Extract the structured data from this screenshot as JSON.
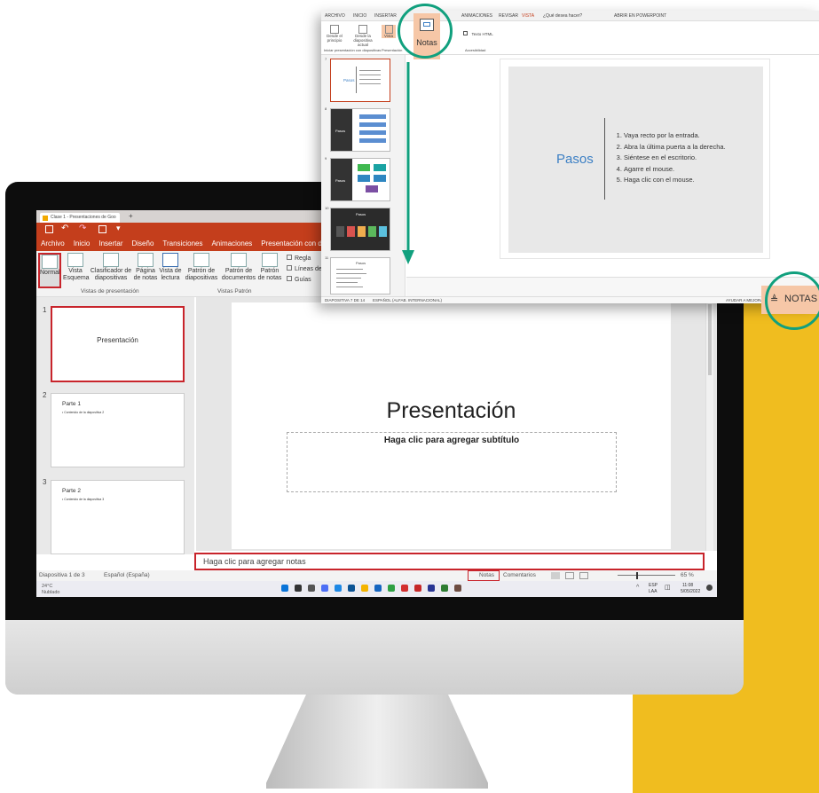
{
  "screen": {
    "window_title": "Clase 1 - Presentaciones de Goo",
    "tabs": [
      "Archivo",
      "Inicio",
      "Insertar",
      "Diseño",
      "Transiciones",
      "Animaciones",
      "Presentación con diapositivas"
    ],
    "ribbon_buttons": [
      {
        "id": "normal",
        "label": "Normal"
      },
      {
        "id": "esquema",
        "label": "Vista Esquema"
      },
      {
        "id": "clasificador",
        "label": "Clasificador de diapositivas"
      },
      {
        "id": "pagina-notas",
        "label": "Página de notas"
      },
      {
        "id": "lectura",
        "label": "Vista de lectura"
      },
      {
        "id": "patron-diap",
        "label": "Patrón de diapositivas"
      },
      {
        "id": "patron-docs",
        "label": "Patrón de documentos"
      },
      {
        "id": "patron-notas",
        "label": "Patrón de notas"
      }
    ],
    "checkboxes": [
      "Regla",
      "Líneas de",
      "Guías"
    ],
    "groups": [
      "Vistas de presentación",
      "Vistas Patrón"
    ],
    "thumbnails": [
      {
        "num": "1",
        "title": "Presentación",
        "bullet": ""
      },
      {
        "num": "2",
        "title": "Parte 1",
        "bullet": "• Contenido de la diapositiva 2"
      },
      {
        "num": "3",
        "title": "Parte 2",
        "bullet": "• Contenido de la diapositiva 3"
      }
    ],
    "slide_title": "Presentación",
    "slide_subtitle": "Haga clic para agregar subtítulo",
    "notes_placeholder": "Haga clic para agregar notas",
    "status_left": "Diapositiva 1 de 3",
    "status_lang": "Español (España)",
    "status_notes": "Notas",
    "status_comments": "Comentarios",
    "zoom": "65 %",
    "weather_temp": "24°C",
    "weather_desc": "Nublado",
    "tray_lang": "ESP",
    "tray_region": "LAA",
    "clock_time": "11:08",
    "clock_date": "5/05/2022"
  },
  "overlay": {
    "tabs": [
      "ARCHIVO",
      "INICIO",
      "INSERTAR",
      "ANIMACIONES",
      "REVISAR",
      "VISTA",
      "¿Qué desea hacer?",
      "ABRIR EN POWERPOINT"
    ],
    "ribbon": {
      "desde_principio": "Desde el principio",
      "desde_actual": "Desde la diapositiva actual",
      "vista": "Vista",
      "notas": "Notas",
      "texto_html": "Texto HTML",
      "grupo_inicio": "Iniciar presentación con diapositivas",
      "grupo_pres": "Presentación",
      "grupo_acc": "Accesibilidad"
    },
    "thumb_numbers": [
      "7",
      "8",
      "9",
      "10",
      "11"
    ],
    "thumb_titles": [
      "Pasos",
      "Pasos",
      "Pasos",
      "Pasos",
      "Pasos"
    ],
    "slide": {
      "title": "Pasos",
      "steps": [
        "Vaya recto por la entrada.",
        "Abra la última puerta a la derecha.",
        "Siéntese en el escritorio.",
        "Agarre el mouse.",
        "Haga clic con el mouse."
      ]
    },
    "status_left": "DIAPOSITIVA 7 DE 14",
    "status_lang": "ESPAÑOL (ALFAB. INTERNACIONAL)",
    "status_right": "AYUDAR A MEJORAR",
    "notas_label": "NOTAS"
  },
  "colors": {
    "accent_red": "#c43e1c",
    "highlight_red": "#c8242b",
    "teal_circle": "#11a07e",
    "yellow_bg": "#f0bd1f",
    "notas_peach": "#f6c7a7",
    "slide_blue": "#3b7fc4"
  }
}
